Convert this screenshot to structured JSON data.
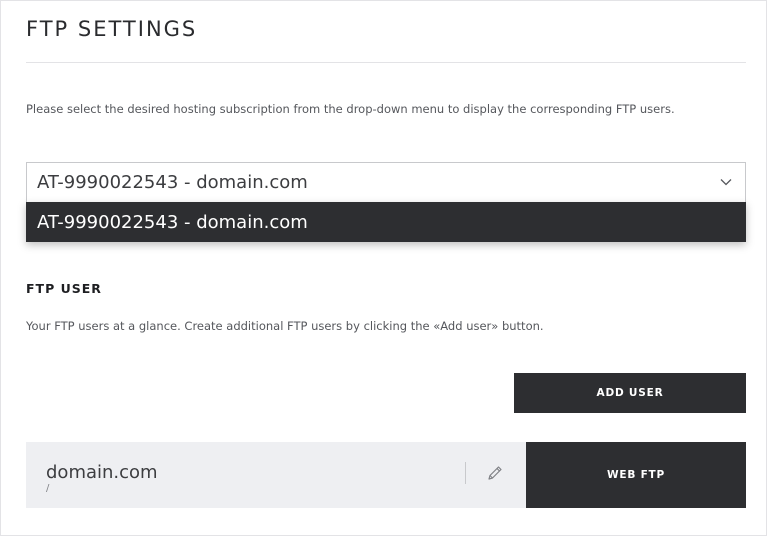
{
  "page": {
    "title": "FTP SETTINGS",
    "intro": "Please select the desired hosting subscription from the drop-down menu to display the corresponding FTP users."
  },
  "subscription_select": {
    "selected_value": "AT-9990022543 - domain.com",
    "options": [
      "AT-9990022543 - domain.com"
    ],
    "icon": "chevron-down-icon"
  },
  "ftp_user_section": {
    "heading": "FTP USER",
    "description": "Your FTP users at a glance. Create additional FTP users by clicking the «Add user» button.",
    "add_user_label": "ADD USER",
    "users": [
      {
        "name": "domain.com",
        "path": "/",
        "edit_icon": "pencil-icon",
        "web_ftp_label": "WEB FTP"
      }
    ]
  },
  "colors": {
    "dark": "#2d2e31",
    "card_bg": "#eeeff2",
    "border": "#c8c9cc"
  }
}
